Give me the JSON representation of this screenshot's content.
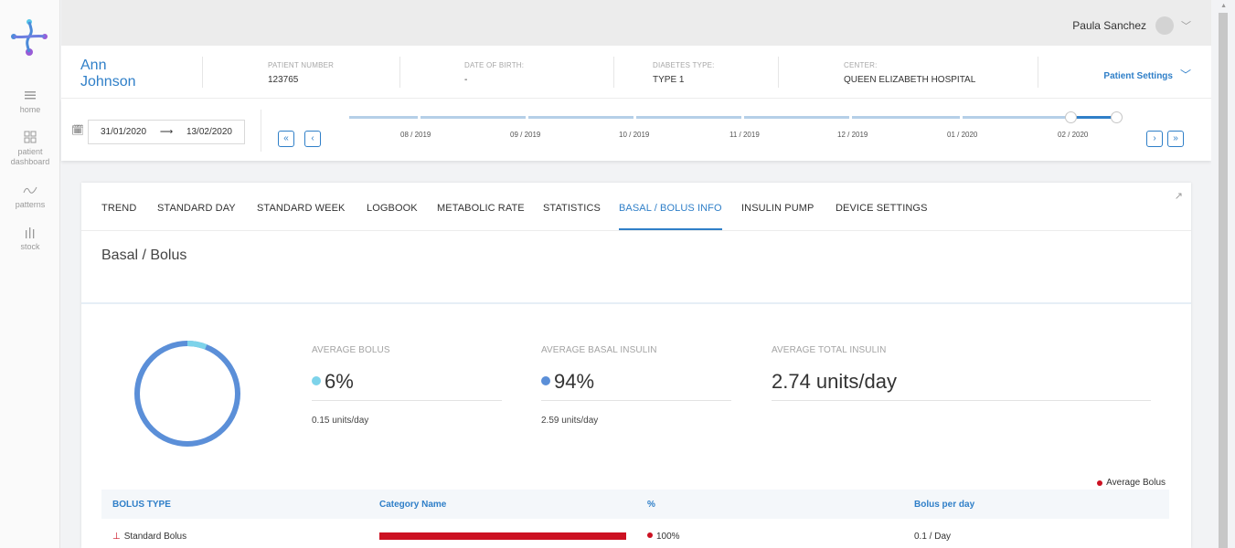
{
  "sidebar": {
    "items": [
      {
        "label": "home",
        "icon": "home-icon"
      },
      {
        "label": "patient dashboard",
        "icon": "grid-icon"
      },
      {
        "label": "patterns",
        "icon": "patterns-icon"
      },
      {
        "label": "stock",
        "icon": "stock-icon"
      }
    ]
  },
  "topbar": {
    "user_name": "Paula Sanchez"
  },
  "patient": {
    "first_name": "Ann",
    "last_name": "Johnson",
    "number_label": "PATIENT NUMBER",
    "number": "123765",
    "dob_label": "DATE OF BIRTH:",
    "dob": "-",
    "diabetes_label": "DIABETES TYPE:",
    "diabetes": "TYPE 1",
    "center_label": "CENTER:",
    "center": "QUEEN ELIZABETH HOSPITAL",
    "settings_label": "Patient Settings"
  },
  "timeline": {
    "start_date": "31/01/2020",
    "end_date": "13/02/2020",
    "arrow": "⟶",
    "months": [
      "08 / 2019",
      "09 / 2019",
      "10 / 2019",
      "11 / 2019",
      "12 / 2019",
      "01 / 2020",
      "02 / 2020"
    ]
  },
  "tabs": [
    "TREND",
    "STANDARD DAY",
    "STANDARD WEEK",
    "LOGBOOK",
    "METABOLIC RATE",
    "STATISTICS",
    "BASAL / BOLUS INFO",
    "INSULIN PUMP",
    "DEVICE SETTINGS"
  ],
  "active_tab": "BASAL / BOLUS INFO",
  "section": {
    "title": "Basal / Bolus"
  },
  "stats": {
    "bolus": {
      "label": "AVERAGE BOLUS",
      "value": "6%",
      "sub": "0.15 units/day",
      "color": "#7dd3ea"
    },
    "basal": {
      "label": "AVERAGE BASAL INSULIN",
      "value": "94%",
      "sub": "2.59 units/day",
      "color": "#5b8fd8"
    },
    "total": {
      "label": "AVERAGE TOTAL INSULIN",
      "value": "2.74 units/day"
    }
  },
  "donut": {
    "bolus_fraction": 0.06,
    "bolus_color": "#7dd3ea",
    "basal_color": "#5b8fd8"
  },
  "legend": {
    "label": "Average Bolus",
    "color": "#cc1122"
  },
  "table": {
    "headers": [
      "BOLUS TYPE",
      "Category Name",
      "%",
      "Bolus per day"
    ],
    "rows": [
      {
        "type": "Standard Bolus",
        "percent": "100%",
        "percent_value": 1.0,
        "per_day": "0.1 / Day"
      }
    ]
  },
  "colors": {
    "accent": "#2f7fc8",
    "bolus_red": "#cc1122"
  }
}
